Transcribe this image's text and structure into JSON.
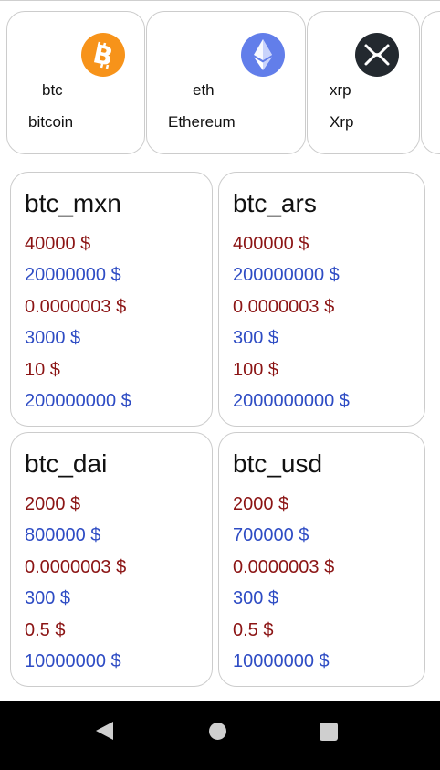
{
  "coins": [
    {
      "symbol": "btc",
      "name": "bitcoin",
      "icon": "bitcoin-icon",
      "color": "#f7931a"
    },
    {
      "symbol": "eth",
      "name": "Ethereum",
      "icon": "ethereum-icon",
      "color": "#627eea"
    },
    {
      "symbol": "xrp",
      "name": "Xrp",
      "icon": "xrp-icon",
      "color": "#23292f"
    }
  ],
  "pairs": [
    {
      "name": "btc_mxn",
      "values": [
        "40000 $",
        "20000000 $",
        "0.0000003 $",
        "3000 $",
        "10 $",
        "200000000 $"
      ]
    },
    {
      "name": "btc_ars",
      "values": [
        "400000 $",
        "200000000 $",
        "0.0000003 $",
        "300 $",
        "100 $",
        "2000000000 $"
      ]
    },
    {
      "name": "btc_dai",
      "values": [
        "2000 $",
        "800000 $",
        "0.0000003 $",
        "300 $",
        "0.5 $",
        "10000000 $"
      ]
    },
    {
      "name": "btc_usd",
      "values": [
        "2000 $",
        "700000 $",
        "0.0000003 $",
        "300 $",
        "0.5 $",
        "10000000 $"
      ]
    }
  ],
  "colors": {
    "price_red": "#8b1414",
    "price_blue": "#2e4cc4"
  },
  "navbar": {
    "back": "back-icon",
    "home": "home-icon",
    "recents": "recents-icon"
  }
}
